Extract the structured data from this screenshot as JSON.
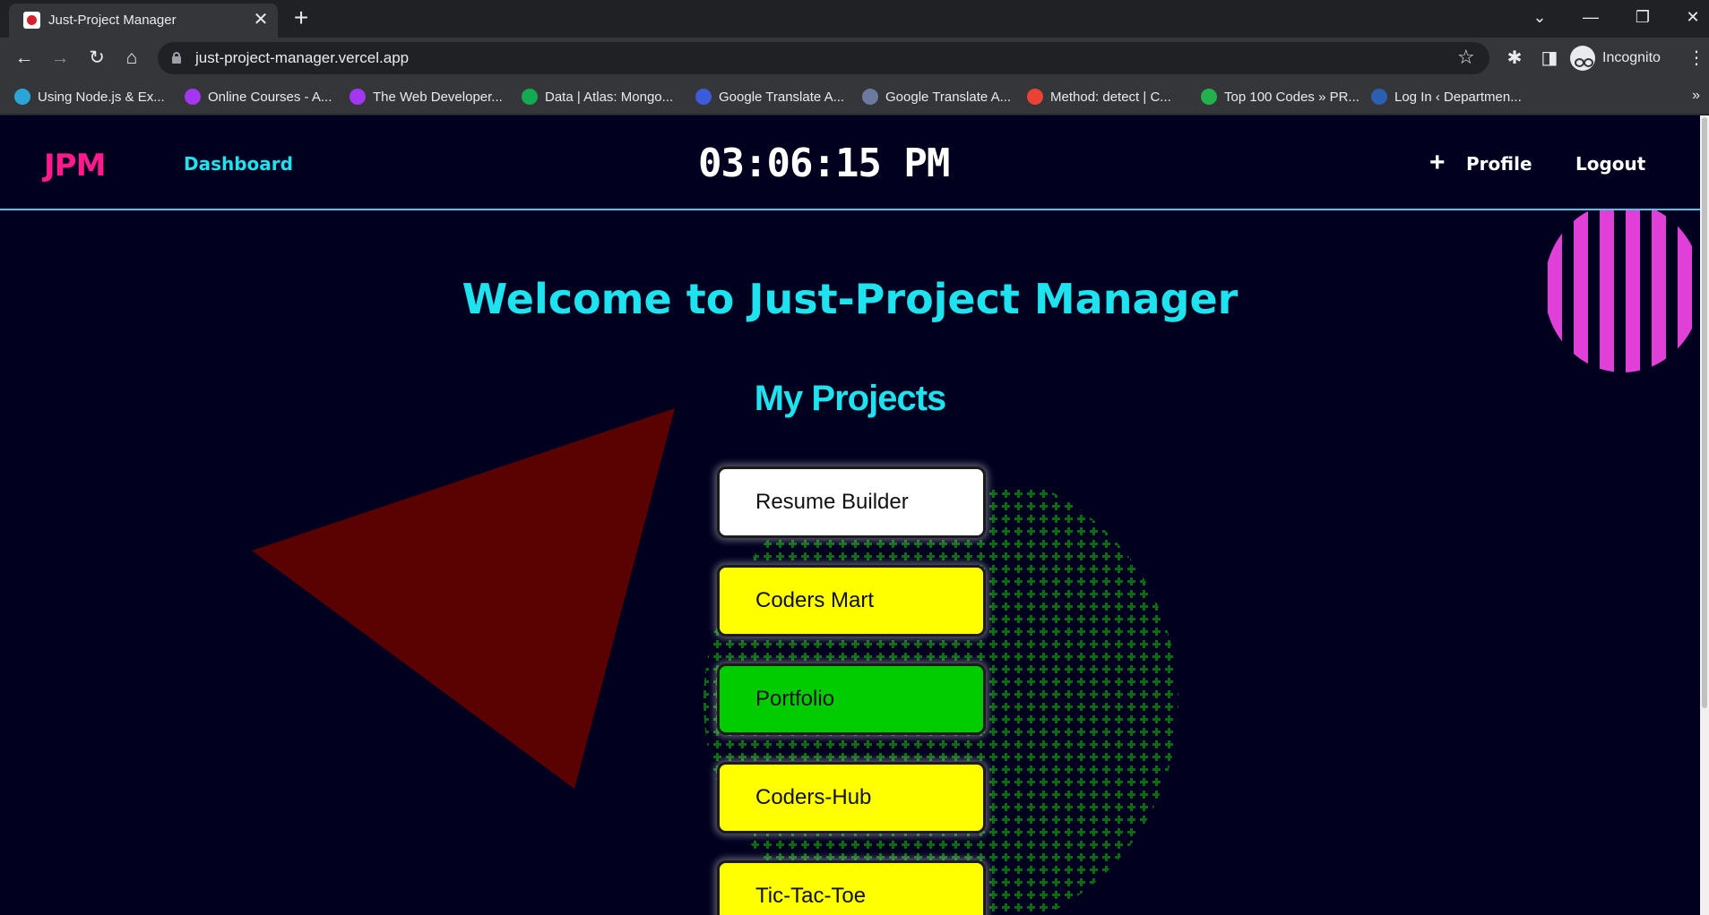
{
  "browser": {
    "tab": {
      "title": "Just-Project Manager",
      "favicon": "jpm-favicon-icon"
    },
    "new_tab_label": "+",
    "url": "just-project-manager.vercel.app",
    "profile_label": "Incognito",
    "bookmarks": [
      {
        "label": "Using Node.js & Ex...",
        "icon_color": "#2aa5d8"
      },
      {
        "label": "Online Courses - A...",
        "icon_color": "#a435f0"
      },
      {
        "label": "The Web Developer...",
        "icon_color": "#a435f0"
      },
      {
        "label": "Data | Atlas: Mongo...",
        "icon_color": "#13aa52"
      },
      {
        "label": "Google Translate A...",
        "icon_color": "#3b5bdb"
      },
      {
        "label": "Google Translate A...",
        "icon_color": "#6c7aa0"
      },
      {
        "label": "Method: detect | C...",
        "icon_color": "#ea4335"
      },
      {
        "label": "Top 100 Codes » PR...",
        "icon_color": "#22b14c"
      },
      {
        "label": "Log In ‹ Departmen...",
        "icon_color": "#2b5fb0"
      }
    ],
    "bookmarks_more": "»"
  },
  "app": {
    "logo": "JPM",
    "nav": {
      "dashboard": "Dashboard",
      "profile": "Profile",
      "logout": "Logout",
      "plus": "+"
    },
    "clock": "03:06:15 PM",
    "welcome": "Welcome to Just-Project Manager",
    "section_title": "My Projects",
    "projects": [
      {
        "name": "Resume Builder",
        "color": "#ffffff"
      },
      {
        "name": "Coders Mart",
        "color": "#ffff00"
      },
      {
        "name": "Portfolio",
        "color": "#00cc00"
      },
      {
        "name": "Coders-Hub",
        "color": "#ffff00"
      },
      {
        "name": "Tic-Tac-Toe",
        "color": "#ffff00"
      }
    ]
  },
  "colors": {
    "page_bg": "#01011f",
    "accent_cyan": "#1ee3ee",
    "logo_pink": "#ff1a8c",
    "triangle": "#5a0202",
    "dots": "#0b6b12",
    "stripes": "#e040d8"
  }
}
